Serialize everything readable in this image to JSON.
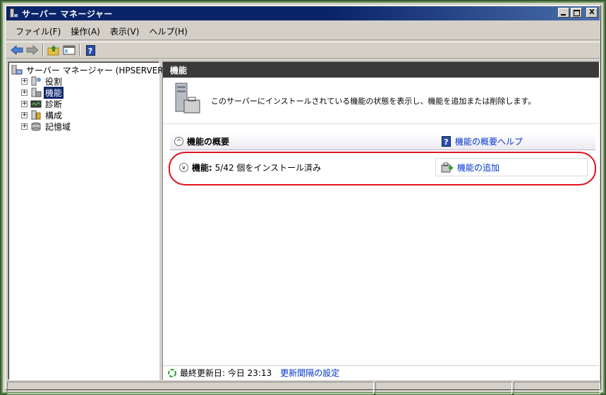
{
  "window": {
    "title": "サーバー マネージャー",
    "controls": {
      "minimize": "_",
      "maximize": "□",
      "close": "X"
    }
  },
  "menu": {
    "items": [
      "ファイル(F)",
      "操作(A)",
      "表示(V)",
      "ヘルプ(H)"
    ]
  },
  "toolbar": {
    "icons": [
      "back-arrow-icon",
      "forward-arrow-icon",
      "up-folder-icon",
      "show-hide-tree-icon",
      "help-icon"
    ],
    "help_glyph": "?"
  },
  "tree": {
    "root": "サーバー マネージャー (HPSERVER)",
    "items": [
      {
        "label": "役割",
        "icon": "roles-icon",
        "expander": "+"
      },
      {
        "label": "機能",
        "icon": "features-icon",
        "expander": "+",
        "selected": true
      },
      {
        "label": "診断",
        "icon": "diagnostics-icon",
        "expander": "+"
      },
      {
        "label": "構成",
        "icon": "configuration-icon",
        "expander": "+"
      },
      {
        "label": "記憶域",
        "icon": "storage-icon",
        "expander": "+"
      }
    ]
  },
  "content": {
    "header": "機能",
    "description": "このサーバーにインストールされている機能の状態を表示し、機能を追加または削除します。",
    "summary_section": {
      "toggle": "^",
      "title": "機能の概要",
      "help_glyph": "?",
      "help_link": "機能の概要ヘルプ"
    },
    "features_row": {
      "toggle": "v",
      "label": "機能:",
      "status": "5/42 個をインストール済み",
      "action": "機能の追加"
    },
    "footer": {
      "last_updated": "最終更新日: 今日 23:13",
      "refresh_settings_link": "更新間隔の設定"
    }
  },
  "colors": {
    "titlebar": "#0a246a",
    "header_bar": "#3a3a3a",
    "link": "#0033cc",
    "highlight": "#e0141e",
    "selection": "#0a246a"
  }
}
